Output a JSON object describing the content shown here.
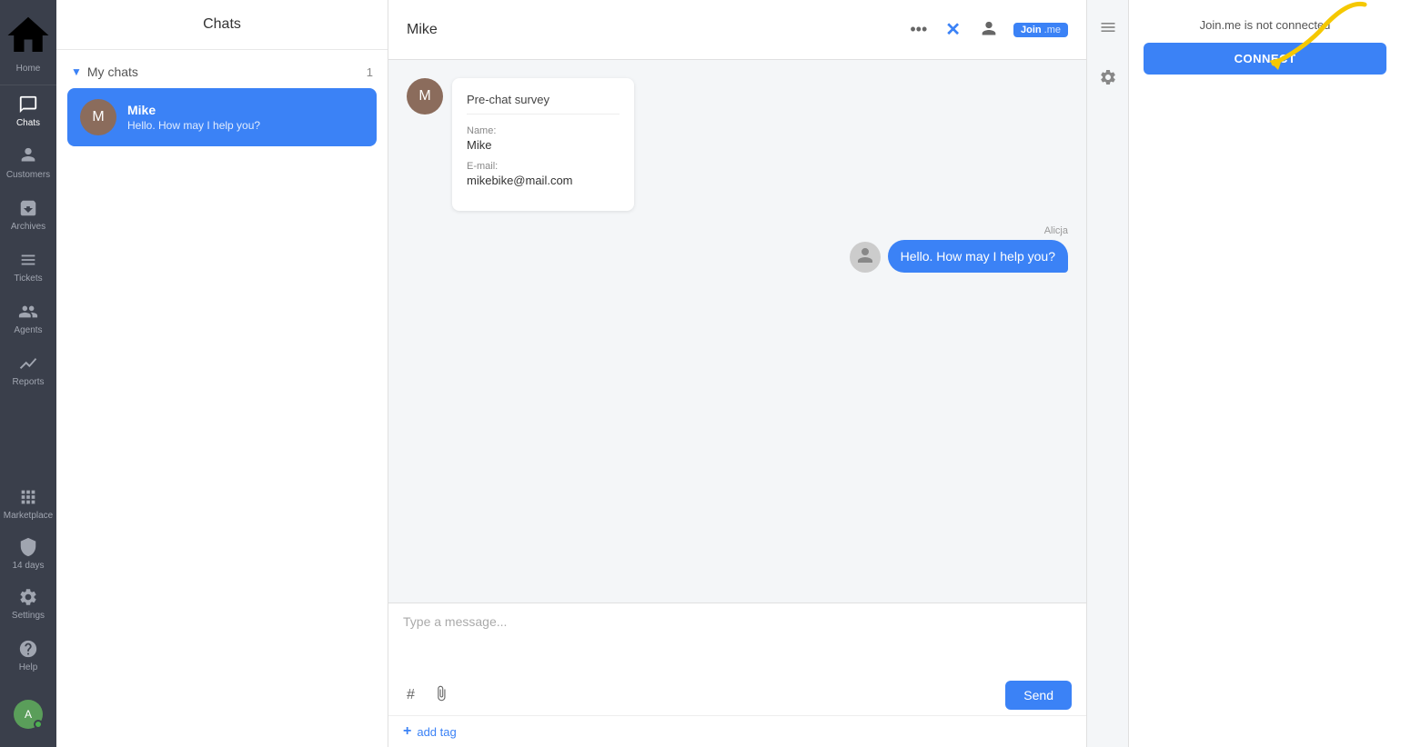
{
  "sidebar": {
    "home_label": "Home",
    "chats_label": "Chats",
    "customers_label": "Customers",
    "archives_label": "Archives",
    "tickets_label": "Tickets",
    "agents_label": "Agents",
    "reports_label": "Reports",
    "marketplace_label": "Marketplace",
    "trial_label": "14 days",
    "settings_label": "Settings",
    "help_label": "Help"
  },
  "chats_panel": {
    "title": "Chats",
    "my_chats_label": "My chats",
    "my_chats_count": "1",
    "chat_items": [
      {
        "initial": "M",
        "name": "Mike",
        "preview": "Hello. How may I help you?"
      }
    ]
  },
  "chat": {
    "title": "Mike",
    "pre_chat_survey_title": "Pre-chat survey",
    "name_label": "Name:",
    "name_value": "Mike",
    "email_label": "E-mail:",
    "email_value": "mikebike@mail.com",
    "agent_name": "Alicja",
    "message": "Hello. How may I help you?",
    "message_placeholder": "Type a message...",
    "send_label": "Send",
    "add_tag_label": "add tag",
    "customer_initial": "M"
  },
  "right_panel": {
    "joinme_status": "Join.me is not connected",
    "connect_label": "CONNECT"
  }
}
